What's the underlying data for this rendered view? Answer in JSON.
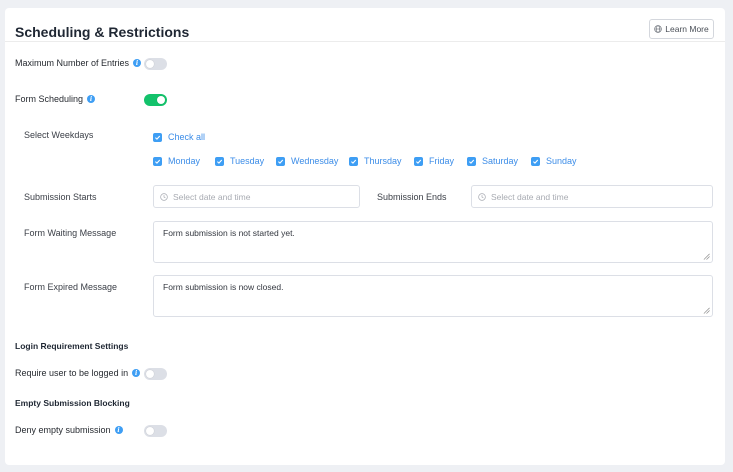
{
  "header": {
    "title": "Scheduling & Restrictions",
    "learn_more": "Learn More"
  },
  "max_entries": {
    "label": "Maximum Number of Entries",
    "enabled": false
  },
  "form_scheduling": {
    "label": "Form Scheduling",
    "enabled": true,
    "weekdays_label": "Select Weekdays",
    "check_all": "Check all",
    "days": [
      "Monday",
      "Tuesday",
      "Wednesday",
      "Thursday",
      "Friday",
      "Saturday",
      "Sunday"
    ],
    "starts_label": "Submission Starts",
    "starts_placeholder": "Select date and time",
    "ends_label": "Submission Ends",
    "ends_placeholder": "Select date and time",
    "waiting_label": "Form Waiting Message",
    "waiting_value": "Form submission is not started yet.",
    "expired_label": "Form Expired Message",
    "expired_value": "Form submission is now closed."
  },
  "login": {
    "section": "Login Requirement Settings",
    "label": "Require user to be logged in",
    "enabled": false
  },
  "empty": {
    "section": "Empty Submission Blocking",
    "label": "Deny empty submission",
    "enabled": false
  },
  "colors": {
    "accent": "#3e9ef4",
    "toggle_on": "#13c26b",
    "toggle_off": "#dcdfe6",
    "background": "#eef0f4"
  },
  "icons": {
    "learn_more": "globe-icon",
    "info": "info-icon",
    "date": "clock-icon",
    "check": "checkmark-icon"
  }
}
